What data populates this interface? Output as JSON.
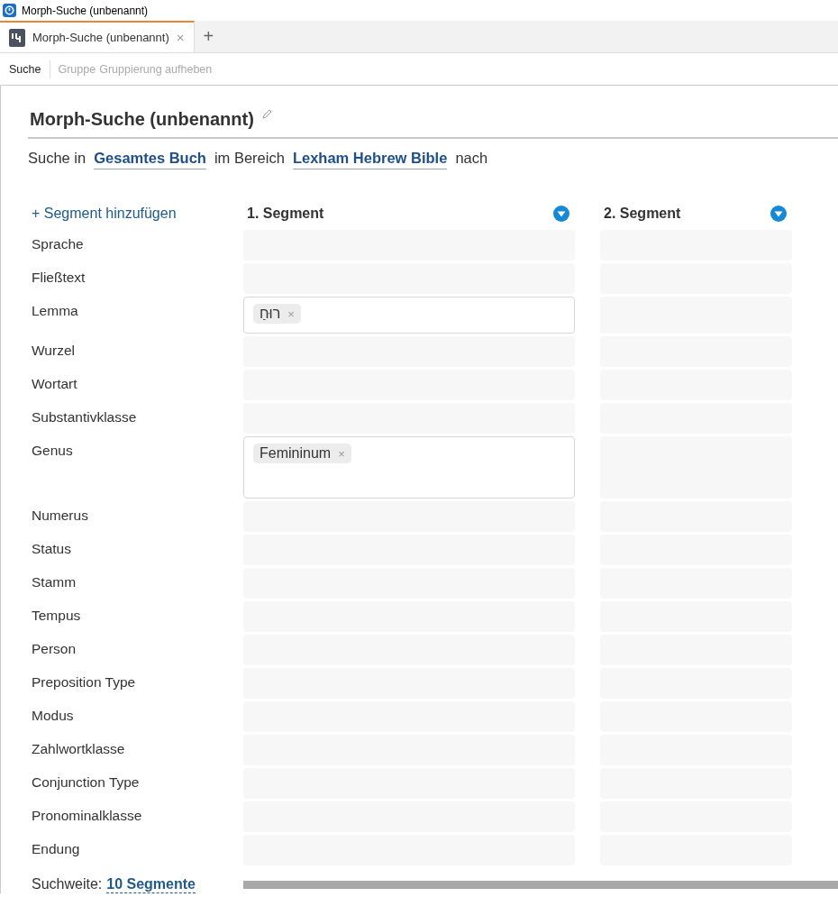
{
  "window": {
    "title": "Morph-Suche (unbenannt)"
  },
  "tabs": [
    {
      "label": "Morph-Suche (unbenannt)",
      "selected": true,
      "close": "×"
    }
  ],
  "new_tab": "+",
  "toolbar": [
    {
      "label": "Suche",
      "disabled": false
    },
    {
      "label": "Gruppe",
      "disabled": true
    },
    {
      "label": "Gruppierung aufheben",
      "disabled": true
    }
  ],
  "heading": "Morph-Suche (unbenannt)",
  "scope": [
    {
      "kind": "text",
      "text": "Suche in"
    },
    {
      "kind": "link",
      "text": "Gesamtes Buch"
    },
    {
      "kind": "text",
      "text": "im Bereich"
    },
    {
      "kind": "link",
      "text": "Lexham Hebrew Bible"
    },
    {
      "kind": "text",
      "text": "nach"
    }
  ],
  "add_segment": "+ Segment hinzufügen",
  "segments": [
    {
      "title": "1. Segment"
    },
    {
      "title": "2. Segment"
    }
  ],
  "rows": [
    {
      "label": "Sprache",
      "kind": "field"
    },
    {
      "label": "Fließtext",
      "kind": "field"
    },
    {
      "label": "Lemma",
      "kind": "field",
      "segment_1": [
        {
          "text": "רוּחַ",
          "remove": "×"
        }
      ]
    },
    {
      "label": "Wurzel",
      "kind": "field"
    },
    {
      "label": "Wortart",
      "kind": "field"
    },
    {
      "label": "Substantivklasse",
      "kind": "field"
    },
    {
      "label": "Genus",
      "kind": "tall",
      "segment_1": [
        {
          "text": "Femininum",
          "remove": "×"
        }
      ]
    },
    {
      "label": "Numerus",
      "kind": "field"
    },
    {
      "label": "Status",
      "kind": "field"
    },
    {
      "label": "Stamm",
      "kind": "field"
    },
    {
      "label": "Tempus",
      "kind": "field"
    },
    {
      "label": "Person",
      "kind": "field"
    },
    {
      "label": "Preposition Type",
      "kind": "field"
    },
    {
      "label": "Modus",
      "kind": "field"
    },
    {
      "label": "Zahlwortklasse",
      "kind": "field"
    },
    {
      "label": "Conjunction Type",
      "kind": "field"
    },
    {
      "label": "Pronominalklasse",
      "kind": "field"
    },
    {
      "label": "Endung",
      "kind": "field"
    }
  ],
  "range": {
    "label": "Suchweite:",
    "value": "10 Segmente"
  }
}
